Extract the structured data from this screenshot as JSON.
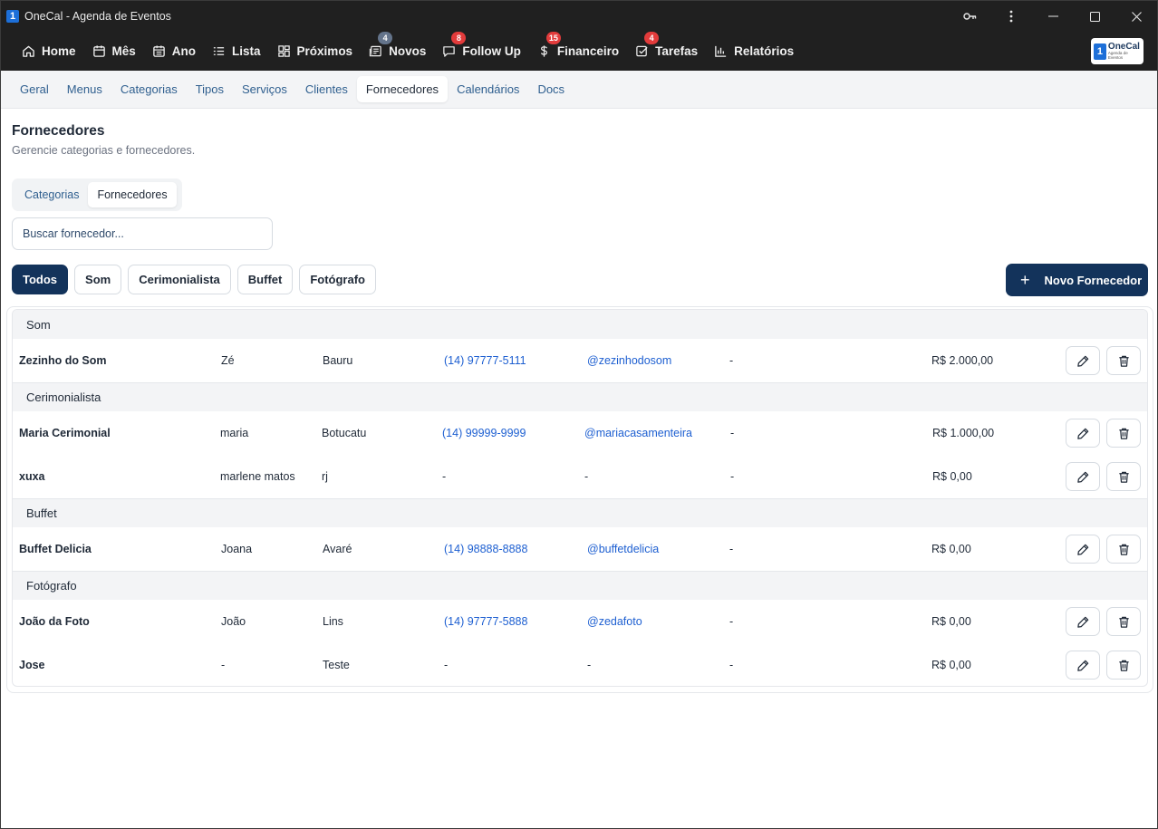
{
  "window": {
    "title": "OneCal - Agenda de Eventos",
    "app_icon": "1"
  },
  "topnav": {
    "items": [
      {
        "label": "Home",
        "icon": "home-icon"
      },
      {
        "label": "Mês",
        "icon": "calendar-icon"
      },
      {
        "label": "Ano",
        "icon": "calendar-grid-icon"
      },
      {
        "label": "Lista",
        "icon": "list-icon"
      },
      {
        "label": "Próximos",
        "icon": "dashboard-icon"
      },
      {
        "label": "Novos",
        "icon": "newspaper-icon",
        "badge": "4"
      },
      {
        "label": "Follow Up",
        "icon": "message-icon",
        "badge": "8"
      },
      {
        "label": "Financeiro",
        "icon": "dollar-icon",
        "badge": "15"
      },
      {
        "label": "Tarefas",
        "icon": "check-square-icon",
        "badge": "4"
      },
      {
        "label": "Relatórios",
        "icon": "bar-chart-icon"
      }
    ],
    "logo": {
      "mark": "1",
      "name": "OneCal",
      "tagline": "Agenda de Eventos"
    }
  },
  "settings_tabs": {
    "items": [
      "Geral",
      "Menus",
      "Categorias",
      "Tipos",
      "Serviços",
      "Clientes",
      "Fornecedores",
      "Calendários",
      "Docs"
    ],
    "active": "Fornecedores"
  },
  "page": {
    "title": "Fornecedores",
    "subtitle": "Gerencie categorias e fornecedores."
  },
  "segment": {
    "items": [
      "Categorias",
      "Fornecedores"
    ],
    "active": "Fornecedores"
  },
  "search": {
    "placeholder": "Buscar fornecedor...",
    "value": ""
  },
  "filters": {
    "items": [
      "Todos",
      "Som",
      "Cerimonialista",
      "Buffet",
      "Fotógrafo"
    ],
    "active": "Todos"
  },
  "new_button": {
    "label": "Novo Fornecedor",
    "icon": "plus-icon"
  },
  "colors": {
    "primary": "#13335b",
    "link": "#1d5fd1",
    "titlebar": "#202020",
    "badge_red": "#e23b3b",
    "badge_gray": "#64748b"
  },
  "groups": [
    {
      "name": "Som",
      "rows": [
        {
          "name": "Zezinho do Som",
          "contact": "Zé",
          "city": "Bauru",
          "phone": "(14) 97777-5111",
          "instagram": "@zezinhodosom",
          "extra": "-",
          "price": "R$ 2.000,00"
        }
      ]
    },
    {
      "name": "Cerimonialista",
      "rows": [
        {
          "name": "Maria Cerimonial",
          "contact": "maria",
          "city": "Botucatu",
          "phone": "(14) 99999-9999",
          "instagram": "@mariacasamenteira",
          "extra": "-",
          "price": "R$ 1.000,00"
        },
        {
          "name": "xuxa",
          "contact": "marlene matos",
          "city": "rj",
          "phone": "-",
          "instagram": "-",
          "extra": "-",
          "price": "R$ 0,00"
        }
      ]
    },
    {
      "name": "Buffet",
      "rows": [
        {
          "name": "Buffet Delicia",
          "contact": "Joana",
          "city": "Avaré",
          "phone": "(14) 98888-8888",
          "instagram": "@buffetdelicia",
          "extra": "-",
          "price": "R$ 0,00"
        }
      ]
    },
    {
      "name": "Fotógrafo",
      "rows": [
        {
          "name": "João da Foto",
          "contact": "João",
          "city": "Lins",
          "phone": "(14) 97777-5888",
          "instagram": "@zedafoto",
          "extra": "-",
          "price": "R$ 0,00"
        },
        {
          "name": "Jose",
          "contact": "-",
          "city": "Teste",
          "phone": "-",
          "instagram": "-",
          "extra": "-",
          "price": "R$ 0,00"
        }
      ]
    }
  ]
}
